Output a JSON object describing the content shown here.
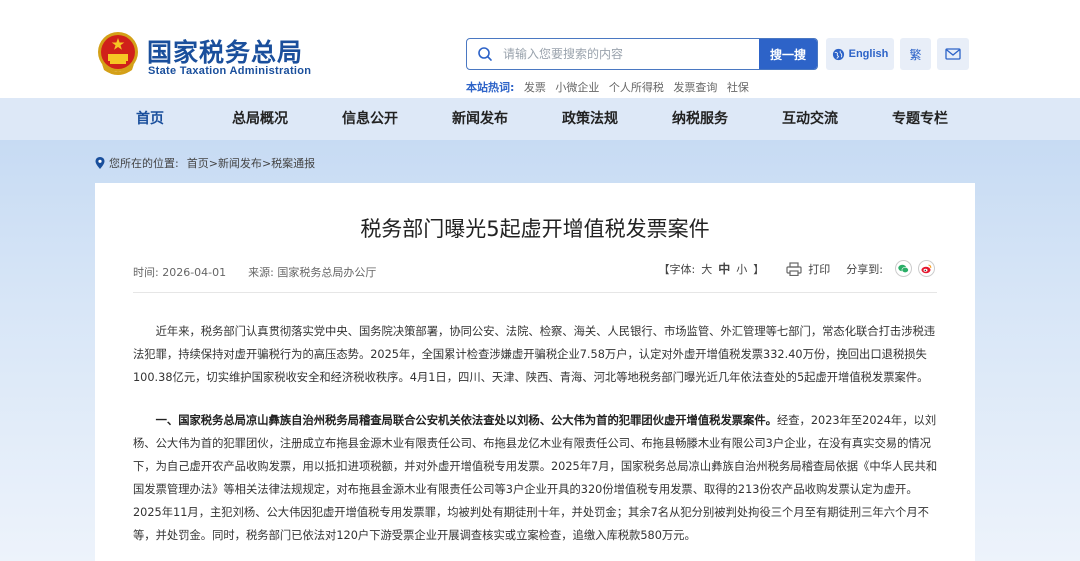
{
  "header": {
    "logo_cn": "国家税务总局",
    "logo_en": "State Taxation Administration",
    "search_placeholder": "请输入您要搜索的内容",
    "search_button": "搜一搜",
    "hot_label": "本站热词:",
    "hot_words": [
      "发票",
      "小微企业",
      "个人所得税",
      "发票查询",
      "社保"
    ],
    "lang_label": "English",
    "traditional_label": "繁"
  },
  "nav": {
    "items": [
      {
        "label": "首页",
        "active": true
      },
      {
        "label": "总局概况",
        "active": false
      },
      {
        "label": "信息公开",
        "active": false
      },
      {
        "label": "新闻发布",
        "active": false
      },
      {
        "label": "政策法规",
        "active": false
      },
      {
        "label": "纳税服务",
        "active": false
      },
      {
        "label": "互动交流",
        "active": false
      },
      {
        "label": "专题专栏",
        "active": false
      }
    ]
  },
  "breadcrumb": {
    "prefix": "您所在的位置:",
    "path": [
      "首页",
      "新闻发布",
      "税案通报"
    ],
    "separator": ">"
  },
  "article": {
    "title": "税务部门曝光5起虚开增值税发票案件",
    "time_label": "时间: 2026-04-01",
    "source_label": "来源: 国家税务总局办公厅",
    "font_size_label": "【字体:",
    "font_sizes": [
      "大",
      "中",
      "小"
    ],
    "font_size_close": "】",
    "print_label": "打印",
    "share_label": "分享到:",
    "paragraph1": "近年来，税务部门认真贯彻落实党中央、国务院决策部署，协同公安、法院、检察、海关、人民银行、市场监管、外汇管理等七部门，常态化联合打击涉税违法犯罪，持续保持对虚开骗税行为的高压态势。2025年，全国累计检查涉嫌虚开骗税企业7.58万户，认定对外虚开增值税发票332.40万份，挽回出口退税损失100.38亿元，切实维护国家税收安全和经济税收秩序。4月1日，四川、天津、陕西、青海、河北等地税务部门曝光近几年依法查处的5起虚开增值税发票案件。",
    "paragraph2_heading": "一、国家税务总局凉山彝族自治州税务局稽查局联合公安机关依法查处以刘杨、公大伟为首的犯罪团伙虚开增值税发票案件。",
    "paragraph2_body": "经查，2023年至2024年，以刘杨、公大伟为首的犯罪团伙，注册成立布拖县金源木业有限责任公司、布拖县龙亿木业有限责任公司、布拖县畅滕木业有限公司3户企业，在没有真实交易的情况下，为自己虚开农产品收购发票，用以抵扣进项税额，并对外虚开增值税专用发票。2025年7月，国家税务总局凉山彝族自治州税务局稽查局依据《中华人民共和国发票管理办法》等相关法律法规规定，对布拖县金源木业有限责任公司等3户企业开具的320份增值税专用发票、取得的213份农产品收购发票认定为虚开。2025年11月，主犯刘杨、公大伟因犯虚开增值税专用发票罪，均被判处有期徒刑十年，并处罚金；其余7名从犯分别被判处拘役三个月至有期徒刑三年六个月不等，并处罚金。同时，税务部门已依法对120户下游受票企业开展调查核实或立案检查，追缴入库税款580万元。"
  },
  "colors": {
    "brand": "#1a4f9c",
    "accent": "#2d63c8",
    "nav_bg": "#dde8f7",
    "wechat": "#2aae67",
    "weibo": "#e6162d"
  }
}
